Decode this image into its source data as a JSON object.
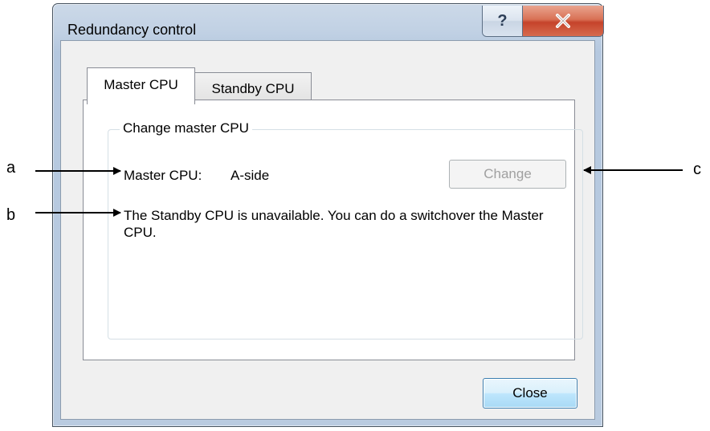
{
  "window": {
    "title": "Redundancy control",
    "help_glyph": "?"
  },
  "tabs": [
    {
      "label": "Master CPU",
      "active": true
    },
    {
      "label": "Standby CPU",
      "active": false
    }
  ],
  "group": {
    "legend": "Change master CPU",
    "master_cpu_label": "Master CPU:",
    "master_cpu_value": "A-side",
    "change_button": "Change",
    "change_enabled": false,
    "message": "The Standby CPU is unavailable. You can do a switchover the Master CPU."
  },
  "footer": {
    "close_button": "Close"
  },
  "callouts": {
    "a": "a",
    "b": "b",
    "c": "c"
  },
  "colors": {
    "frame": "#b9cbe0",
    "close_caption": "#c5432b",
    "default_button_border": "#3c7fb1",
    "disabled_text": "#a0a0a0"
  }
}
